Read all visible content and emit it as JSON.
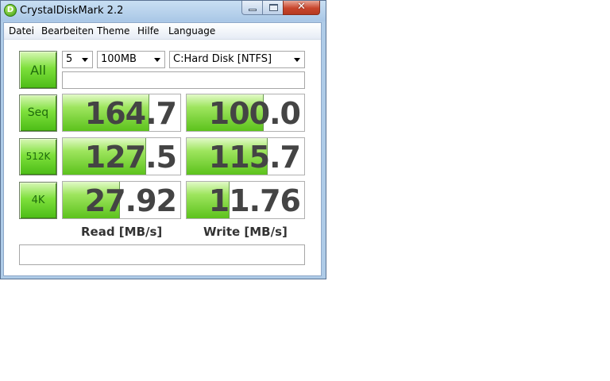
{
  "window": {
    "title": "CrystalDiskMark 2.2",
    "icon_glyph": "D"
  },
  "menu": [
    "Datei",
    "Bearbeiten",
    "Theme",
    "Hilfe",
    "Language"
  ],
  "controls": {
    "all_label": "All",
    "test_count": "5",
    "test_size": "100MB",
    "drive": "C:Hard Disk [NTFS]"
  },
  "rows": [
    {
      "label": "Seq",
      "read": "164.7",
      "write": "100.0",
      "read_fill": 0.73,
      "write_fill": 0.65
    },
    {
      "label": "512K",
      "read": "127.5",
      "write": "115.7",
      "read_fill": 0.7,
      "write_fill": 0.68
    },
    {
      "label": "4K",
      "read": "27.92",
      "write": "11.76",
      "read_fill": 0.48,
      "write_fill": 0.36
    }
  ],
  "columns": {
    "read": "Read [MB/s]",
    "write": "Write [MB/s]"
  },
  "colors": {
    "accent_green": "#5cc21c",
    "titlebar": "#aecbe7",
    "close": "#c8452c"
  }
}
